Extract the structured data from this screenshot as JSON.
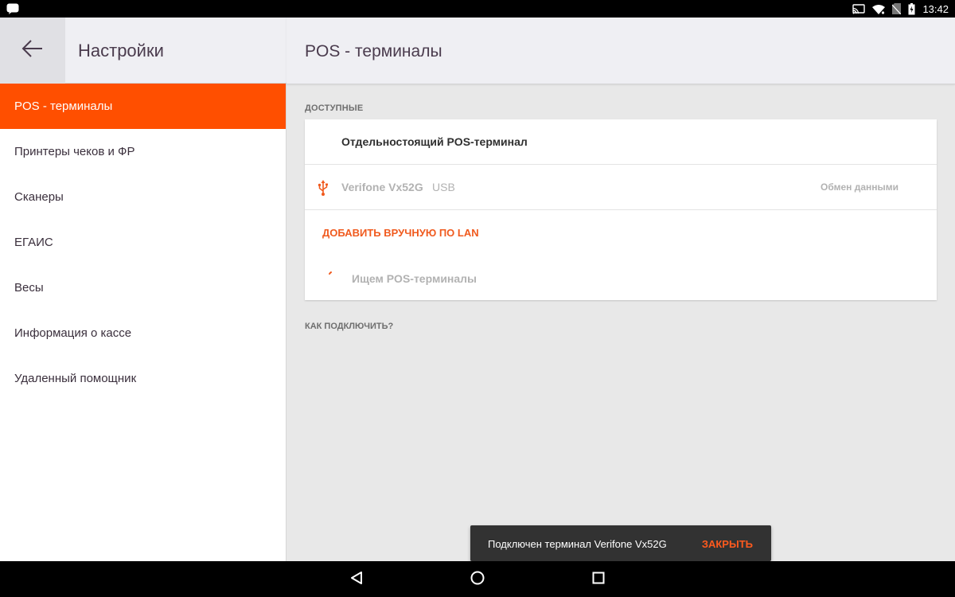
{
  "status_bar": {
    "time": "13:42",
    "icons": [
      "notification-icon",
      "cast-icon",
      "wifi-icon",
      "no-sim-icon",
      "battery-icon"
    ]
  },
  "left_panel": {
    "title": "Настройки",
    "back_icon": "arrow-left-icon",
    "items": [
      {
        "label": "POS - терминалы",
        "active": true
      },
      {
        "label": "Принтеры чеков и ФР"
      },
      {
        "label": "Сканеры"
      },
      {
        "label": "ЕГАИС"
      },
      {
        "label": "Весы"
      },
      {
        "label": "Информация о кассе"
      },
      {
        "label": "Удаленный помощник"
      }
    ]
  },
  "main": {
    "title": "POS - терминалы",
    "section_label": "ДОСТУПНЫЕ",
    "standalone_label": "Отдельностоящий POS-терминал",
    "device": {
      "icon": "usb-icon",
      "name": "Verifone Vx52G",
      "connection": "USB",
      "status": "Обмен данными"
    },
    "add_manual_label": "ДОБАВИТЬ ВРУЧНУЮ ПО LAN",
    "searching_label": "Ищем POS-терминалы",
    "help_link": "КАК ПОДКЛЮЧИТЬ?"
  },
  "snackbar": {
    "message": "Подключен терминал Verifone Vx52G",
    "action": "ЗАКРЫТЬ"
  },
  "colors": {
    "accent": "#ff4f00",
    "link": "#f05a1e",
    "header_bg": "#efeff3",
    "content_bg": "#e8e8e8"
  }
}
